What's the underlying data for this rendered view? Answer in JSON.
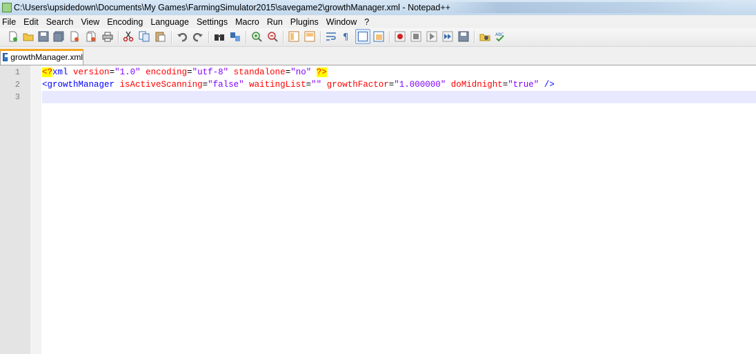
{
  "window": {
    "title": "C:\\Users\\upsidedown\\Documents\\My Games\\FarmingSimulator2015\\savegame2\\growthManager.xml - Notepad++"
  },
  "menu": {
    "items": [
      "File",
      "Edit",
      "Search",
      "View",
      "Encoding",
      "Language",
      "Settings",
      "Macro",
      "Run",
      "Plugins",
      "Window",
      "?"
    ]
  },
  "toolbar": {
    "icons": [
      "new-file-icon",
      "open-file-icon",
      "save-icon",
      "save-all-icon",
      "close-icon",
      "close-all-icon",
      "print-icon",
      "cut-icon",
      "copy-icon",
      "paste-icon",
      "undo-icon",
      "redo-icon",
      "find-icon",
      "replace-icon",
      "zoom-in-icon",
      "zoom-out-icon",
      "sync-vertical-icon",
      "sync-horizontal-icon",
      "word-wrap-icon",
      "show-all-chars-icon",
      "indent-guide-icon",
      "document-map-icon",
      "record-macro-icon",
      "stop-recording-icon",
      "play-macro-icon",
      "run-macro-multiple-icon",
      "save-macro-icon",
      "launch-browser-icon",
      "spell-check-icon"
    ],
    "pressed": "indent-guide-icon"
  },
  "tabs": [
    {
      "label": "growthManager.xml",
      "active": true
    }
  ],
  "editor": {
    "line_numbers": [
      "1",
      "2",
      "3"
    ],
    "current_line": 3,
    "lines": [
      {
        "pi_open": "<?",
        "decl": "xml",
        "a1": "version",
        "v1": "\"1.0\"",
        "a2": "encoding",
        "v2": "\"utf-8\"",
        "a3": "standalone",
        "v3": "\"no\"",
        "pi_close": "?>"
      },
      {
        "open": "<growthManager",
        "a1": "isActiveScanning",
        "v1": "\"false\"",
        "a2": "waitingList",
        "v2": "\"\"",
        "a3": "growthFactor",
        "v3": "\"1.000000\"",
        "a4": "doMidnight",
        "v4": "\"true\"",
        "close": "/>"
      },
      {}
    ]
  },
  "colors": {
    "tag": "#0000ff",
    "attribute": "#ff0000",
    "value": "#8000ff",
    "pi_highlight": "#ffff00",
    "current_line": "#e8e8ff"
  }
}
